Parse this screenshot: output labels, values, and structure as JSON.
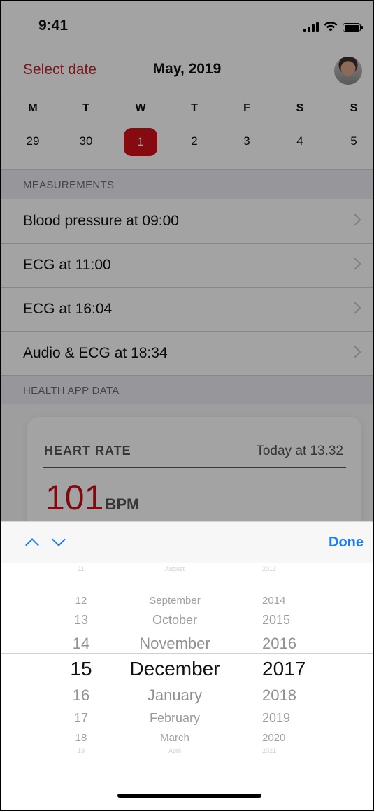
{
  "status_bar": {
    "time": "9:41"
  },
  "header": {
    "select_date": "Select date",
    "title": "May, 2019"
  },
  "week": {
    "days": [
      "M",
      "T",
      "W",
      "T",
      "F",
      "S",
      "S"
    ],
    "dates": [
      "29",
      "30",
      "1",
      "2",
      "3",
      "4",
      "5"
    ],
    "selected_index": 2,
    "accent": "#d0121b"
  },
  "measurements": {
    "header": "MEASUREMENTS",
    "items": [
      {
        "label": "Blood pressure at 09:00"
      },
      {
        "label": "ECG at 11:00"
      },
      {
        "label": "ECG at 16:04"
      },
      {
        "label": "Audio & ECG at 18:34"
      }
    ]
  },
  "health": {
    "header": "HEALTH APP DATA",
    "card": {
      "title": "HEART RATE",
      "subtitle": "Today at 13.32",
      "value": "101",
      "unit": "BPM"
    }
  },
  "picker_toolbar": {
    "done": "Done",
    "accent": "#1c7cf0"
  },
  "picker": {
    "days": [
      "11",
      "12",
      "13",
      "14",
      "15",
      "16",
      "17",
      "18",
      "19"
    ],
    "months": [
      "August",
      "September",
      "October",
      "November",
      "December",
      "January",
      "February",
      "March",
      "April"
    ],
    "years": [
      "2013",
      "2014",
      "2015",
      "2016",
      "2017",
      "2018",
      "2019",
      "2020",
      "2021"
    ],
    "selected": {
      "day": "15",
      "month": "December",
      "year": "2017"
    }
  }
}
